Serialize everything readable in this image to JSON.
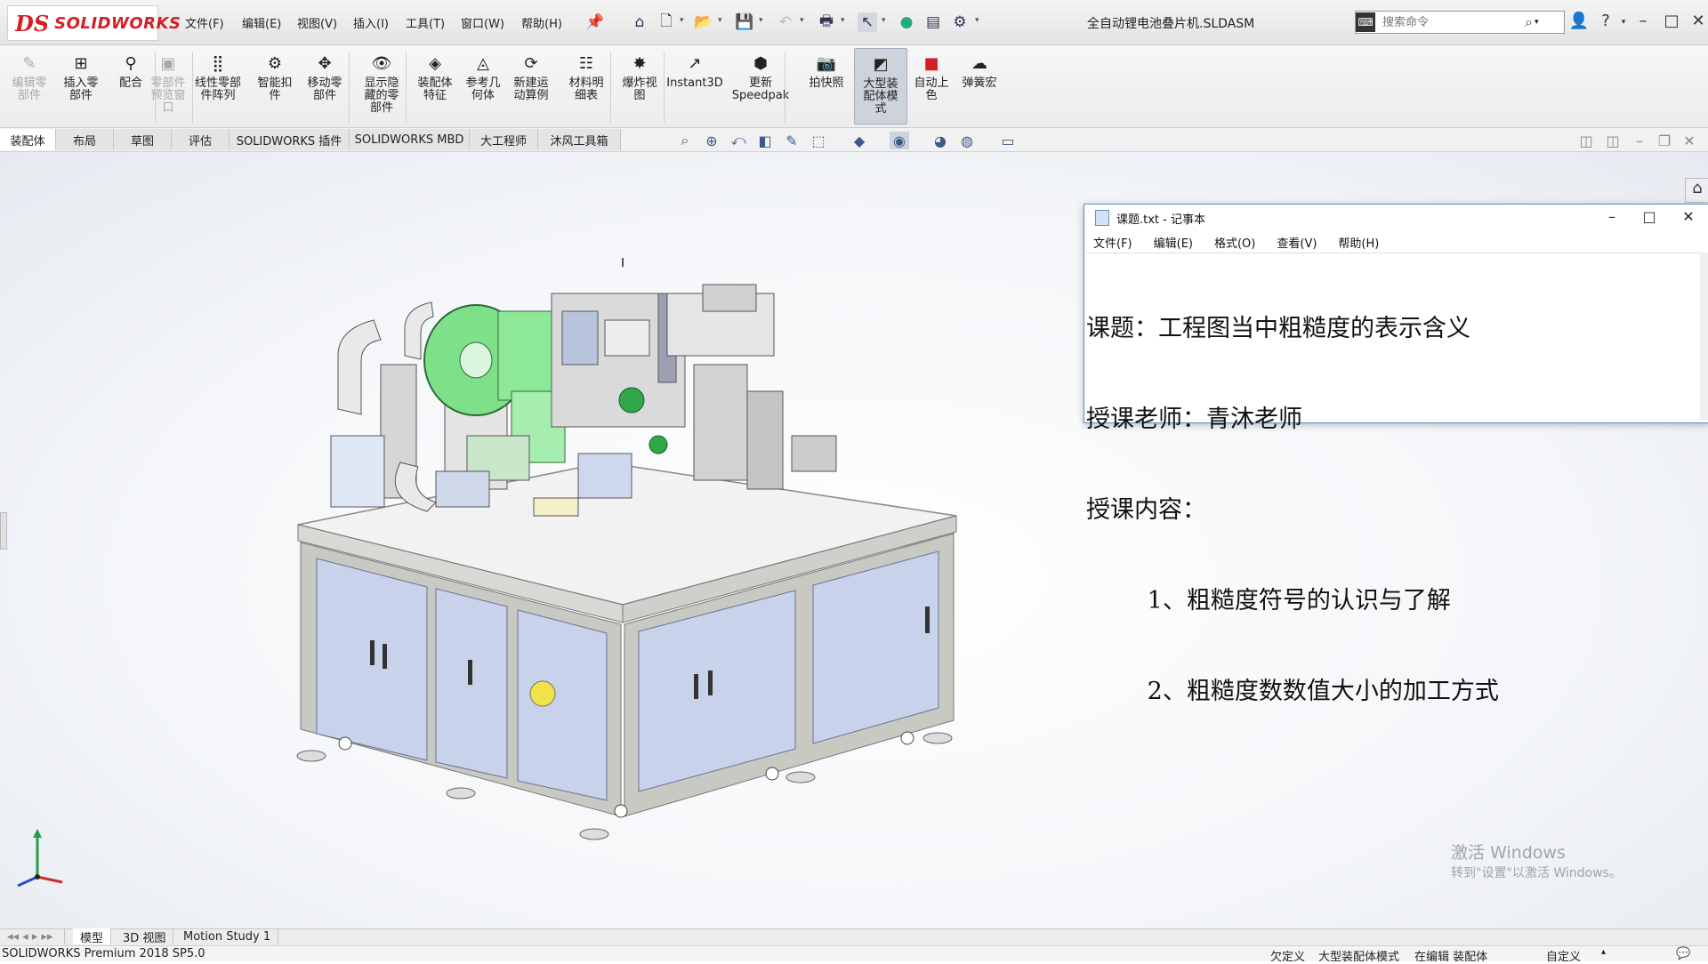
{
  "app": {
    "logo_ds": "DS",
    "logo_text": "SOLIDWORKS",
    "document_title": "全自动锂电池叠片机.SLDASM",
    "menus": [
      "文件(F)",
      "编辑(E)",
      "视图(V)",
      "插入(I)",
      "工具(T)",
      "窗口(W)",
      "帮助(H)"
    ],
    "search_placeholder": "搜索命令"
  },
  "toolbar": {
    "tools": [
      {
        "label": "编辑零\n部件",
        "icon": "edit-component-icon",
        "dim": true
      },
      {
        "label": "插入零\n部件",
        "icon": "insert-component-icon"
      },
      {
        "label": "配合",
        "icon": "mate-icon"
      },
      {
        "label": "零部件\n预览窗\n口",
        "icon": "component-preview-icon",
        "dim": true
      },
      {
        "label": "线性零部\n件阵列",
        "icon": "linear-pattern-icon"
      },
      {
        "label": "智能扣\n件",
        "icon": "smart-fasteners-icon"
      },
      {
        "label": "移动零\n部件",
        "icon": "move-component-icon"
      },
      {
        "label": "显示隐\n藏的零\n部件",
        "icon": "show-hidden-icon"
      },
      {
        "label": "装配体\n特征",
        "icon": "assembly-features-icon"
      },
      {
        "label": "参考几\n何体",
        "icon": "reference-geometry-icon"
      },
      {
        "label": "新建运\n动算例",
        "icon": "new-motion-study-icon"
      },
      {
        "label": "材料明\n细表",
        "icon": "bill-of-materials-icon"
      },
      {
        "label": "爆炸视\n图",
        "icon": "exploded-view-icon"
      },
      {
        "label": "Instant3D",
        "icon": "instant3d-icon"
      },
      {
        "label": "更新\nSpeedpak",
        "icon": "speedpak-icon"
      },
      {
        "label": "拍快照",
        "icon": "snapshot-icon"
      },
      {
        "label": "大型装\n配体模\n式",
        "icon": "large-assembly-icon",
        "selected": true
      },
      {
        "label": "自动上\n色",
        "icon": "auto-color-icon"
      },
      {
        "label": "弹簧宏",
        "icon": "spring-macro-icon"
      }
    ]
  },
  "tabs": [
    "装配体",
    "布局",
    "草图",
    "评估",
    "SOLIDWORKS 插件",
    "SOLIDWORKS MBD",
    "大工程师",
    "沐风工具箱"
  ],
  "notepad": {
    "title": "课题.txt - 记事本",
    "menus": [
      "文件(F)",
      "编辑(E)",
      "格式(O)",
      "查看(V)",
      "帮助(H)"
    ],
    "lines": [
      "课题：工程图当中粗糙度的表示含义",
      "授课老师：青沐老师",
      "授课内容：",
      "        1、粗糙度符号的认识与了解",
      "        2、粗糙度数数值大小的加工方式"
    ]
  },
  "watermark": {
    "line1": "激活 Windows",
    "line2": "转到\"设置\"以激活 Windows。"
  },
  "bottom_tabs": [
    "模型",
    "3D 视图",
    "Motion Study 1"
  ],
  "status": {
    "left": "SOLIDWORKS Premium 2018 SP5.0",
    "items": [
      "欠定义",
      "大型装配体模式",
      "在编辑 装配体",
      "自定义"
    ]
  },
  "colors": {
    "brand": "#d41f26",
    "frame": "#c9c9c4",
    "cabinet": "#c8d2ea",
    "roll": "#7fe08a",
    "selection_blue": "#5a8ad0"
  }
}
